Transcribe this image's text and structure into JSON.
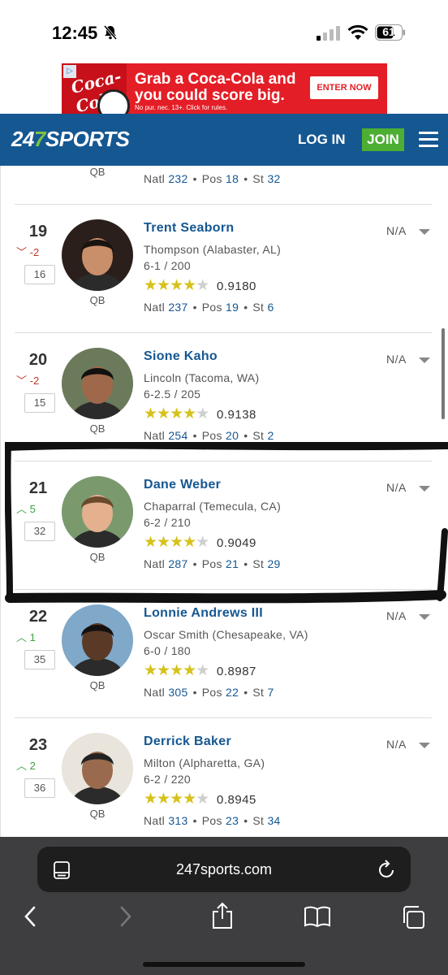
{
  "status_bar": {
    "time": "12:45",
    "battery": "61"
  },
  "ad": {
    "brand": "Coca-Cola",
    "adchoice": "▷",
    "headline": "Grab a Coca-Cola and you could score big.",
    "fine_print": "No pur. nec. 13+. Click for rules.",
    "cta": "ENTER NOW"
  },
  "header": {
    "logo_prefix": "24",
    "logo_seven": "7",
    "logo_suffix": "SPORTS",
    "login": "LOG IN",
    "join": "JOIN"
  },
  "partial_row": {
    "position": "QB",
    "natl_label": "Natl",
    "natl": "232",
    "pos_label": "Pos",
    "pos": "18",
    "st_label": "St",
    "st": "32"
  },
  "players": [
    {
      "rank": "19",
      "change": "-2",
      "change_dir": "down",
      "prev_rank": "16",
      "name": "Trent Seaborn",
      "school": "Thompson (Alabaster, AL)",
      "measurables": "6-1 / 200",
      "stars": 4,
      "rating": "0.9180",
      "position": "QB",
      "natl_label": "Natl",
      "natl": "237",
      "pos_label": "Pos",
      "pos": "19",
      "st_label": "St",
      "st": "6",
      "status": "N/A"
    },
    {
      "rank": "20",
      "change": "-2",
      "change_dir": "down",
      "prev_rank": "15",
      "name": "Sione Kaho",
      "school": "Lincoln (Tacoma, WA)",
      "measurables": "6-2.5 / 205",
      "stars": 4,
      "rating": "0.9138",
      "position": "QB",
      "natl_label": "Natl",
      "natl": "254",
      "pos_label": "Pos",
      "pos": "20",
      "st_label": "St",
      "st": "2",
      "status": "N/A"
    },
    {
      "rank": "21",
      "change": "5",
      "change_dir": "up",
      "prev_rank": "32",
      "name": "Dane Weber",
      "school": "Chaparral (Temecula, CA)",
      "measurables": "6-2 / 210",
      "stars": 4,
      "rating": "0.9049",
      "position": "QB",
      "natl_label": "Natl",
      "natl": "287",
      "pos_label": "Pos",
      "pos": "21",
      "st_label": "St",
      "st": "29",
      "status": "N/A"
    },
    {
      "rank": "22",
      "change": "1",
      "change_dir": "up",
      "prev_rank": "35",
      "name": "Lonnie Andrews III",
      "school": "Oscar Smith (Chesapeake, VA)",
      "measurables": "6-0 / 180",
      "stars": 4,
      "rating": "0.8987",
      "position": "QB",
      "natl_label": "Natl",
      "natl": "305",
      "pos_label": "Pos",
      "pos": "22",
      "st_label": "St",
      "st": "7",
      "status": "N/A"
    },
    {
      "rank": "23",
      "change": "2",
      "change_dir": "up",
      "prev_rank": "36",
      "name": "Derrick Baker",
      "school": "Milton (Alpharetta, GA)",
      "measurables": "6-2 / 220",
      "stars": 4,
      "rating": "0.8945",
      "position": "QB",
      "natl_label": "Natl",
      "natl": "313",
      "pos_label": "Pos",
      "pos": "23",
      "st_label": "St",
      "st": "34",
      "status": "N/A"
    }
  ],
  "browser": {
    "url": "247sports.com"
  },
  "icons": {
    "bell": "bell-slash-icon",
    "signal": "cellular-signal-icon",
    "wifi": "wifi-icon",
    "battery": "battery-icon",
    "menu": "hamburger-menu-icon",
    "tabs": "tabs-icon",
    "reload": "reload-icon",
    "back": "back-icon",
    "forward": "forward-icon",
    "share": "share-icon",
    "bookmarks": "bookmarks-icon",
    "tab_switcher": "tab-switcher-icon"
  },
  "colors": {
    "brand_blue": "#155791",
    "join_green": "#4caf34",
    "star_gold": "#d6c21b",
    "down_red": "#c0392b",
    "up_green": "#3ca043",
    "ad_red": "#e41e26"
  }
}
